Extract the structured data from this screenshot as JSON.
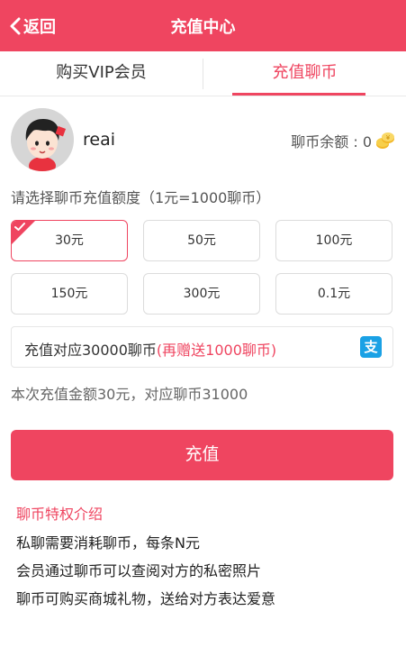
{
  "header": {
    "back_label": "返回",
    "title": "充值中心",
    "bg_color": "#ef4560"
  },
  "tabs": [
    {
      "label": "购买VIP会员",
      "active": false
    },
    {
      "label": "充值聊币",
      "active": true
    }
  ],
  "user": {
    "name": "reai",
    "balance_label": "聊币余额 : 0",
    "avatar_icon": "cartoon-avatar-icon",
    "coin_icon": "coin-icon"
  },
  "recharge": {
    "prompt": "请选择聊币充值额度（1元=1000聊币）",
    "options": [
      "30元",
      "50元",
      "100元",
      "150元",
      "300元",
      "0.1元"
    ],
    "selected_index": 0
  },
  "convert": {
    "text": "充值对应30000聊币",
    "bonus": "(再赠送1000聊币)",
    "payment_icon": "alipay-icon",
    "payment_glyph": "支"
  },
  "summary": "本次充值金额30元，对应聊币31000",
  "pay_button": "充值",
  "privileges": {
    "title": "聊币特权介绍",
    "lines": [
      "私聊需要消耗聊币，每条N元",
      "会员通过聊币可以查阅对方的私密照片",
      "聊币可购买商城礼物，送给对方表达爱意"
    ]
  },
  "colors": {
    "accent": "#ef4560",
    "alipay": "#1aa1e5"
  }
}
